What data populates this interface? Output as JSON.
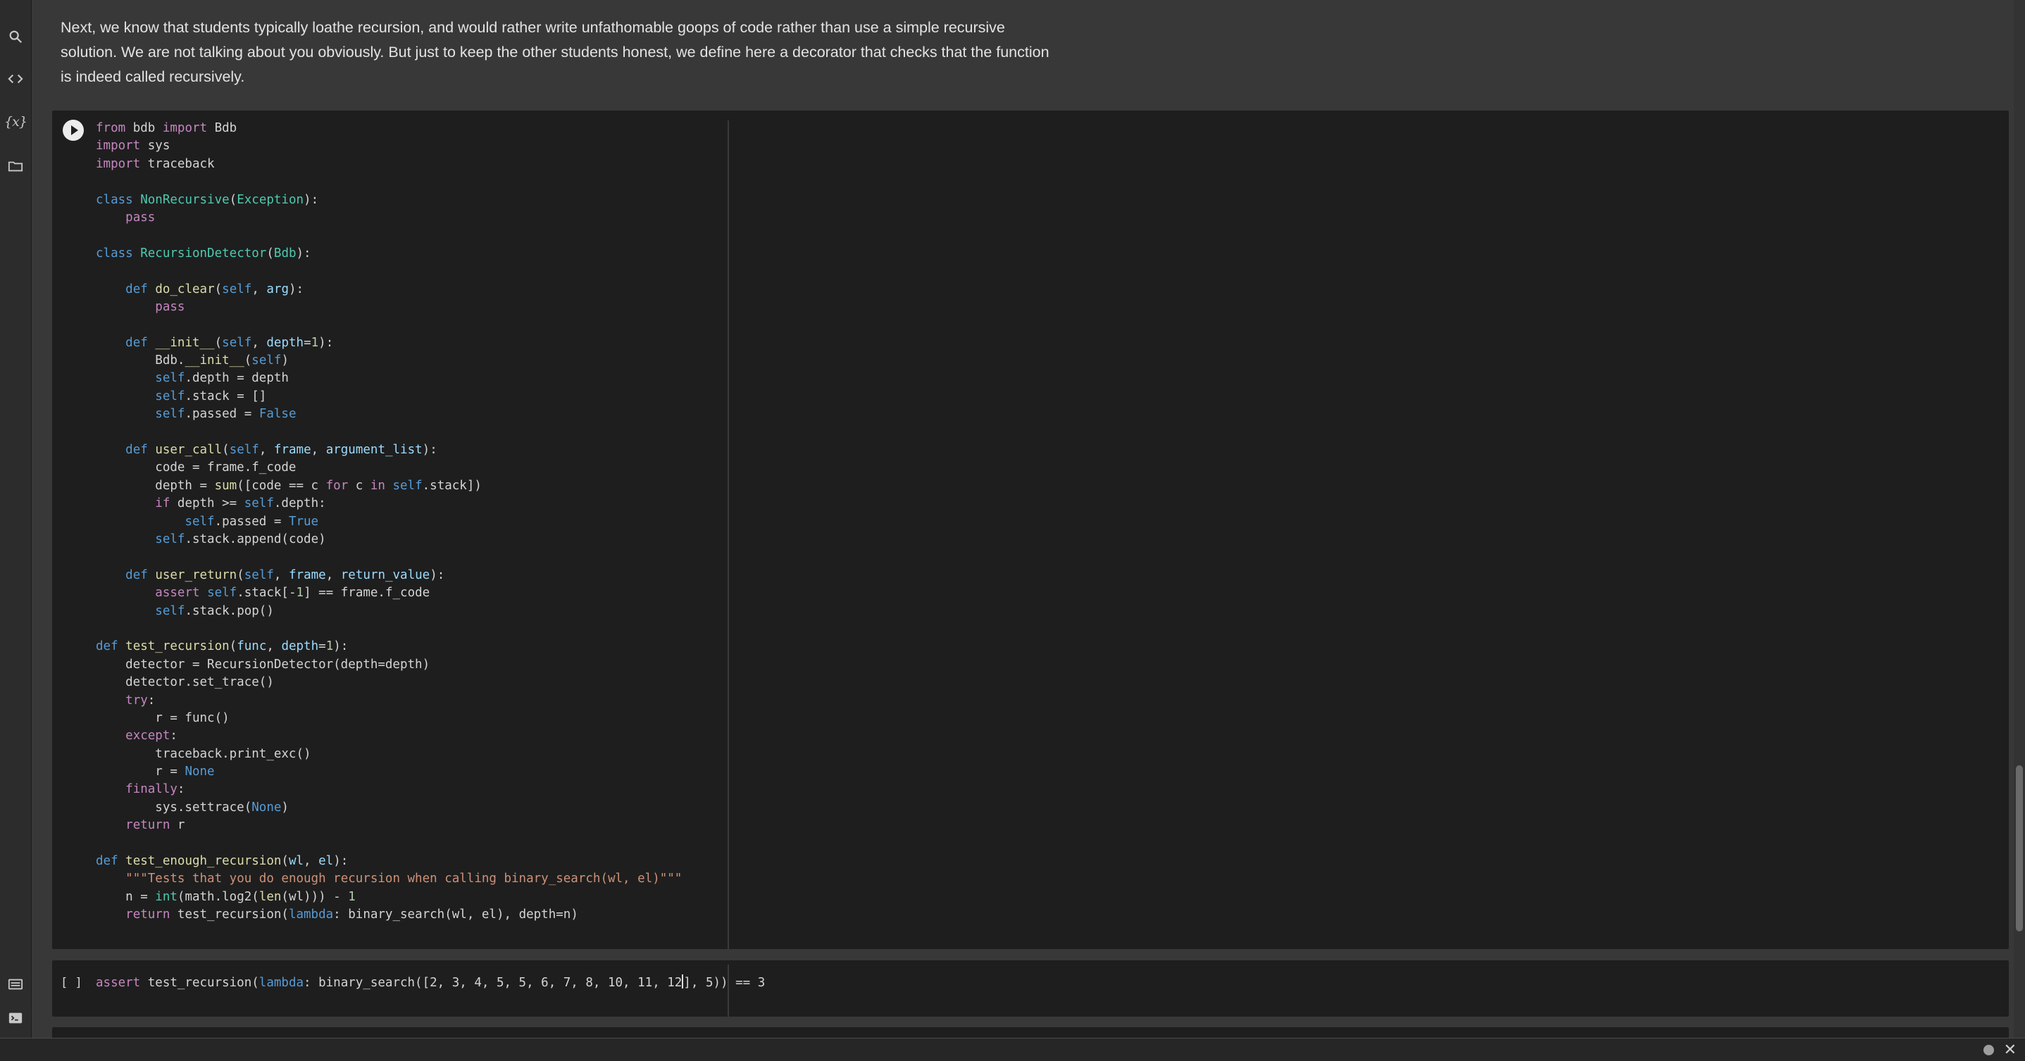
{
  "sidebar": {
    "icons": [
      "search-icon",
      "code-icon",
      "variables-icon",
      "folder-icon",
      "table-of-contents-icon",
      "terminal-icon"
    ],
    "variables_glyph": "{x}"
  },
  "text_cell": {
    "paragraph": "Next, we know that students typically loathe recursion, and would rather write unfathomable goops of code rather than use a simple recursive solution. We are not talking about you obviously. But just to keep the other students honest, we define here a decorator that checks that the function is indeed called recursively."
  },
  "code_cell_1": {
    "code": [
      [
        [
          "kw",
          "from"
        ],
        [
          "txt",
          " bdb "
        ],
        [
          "kw",
          "import"
        ],
        [
          "txt",
          " Bdb"
        ]
      ],
      [
        [
          "kw",
          "import"
        ],
        [
          "txt",
          " sys"
        ]
      ],
      [
        [
          "kw",
          "import"
        ],
        [
          "txt",
          " traceback"
        ]
      ],
      [],
      [
        [
          "kd",
          "class"
        ],
        [
          "txt",
          " "
        ],
        [
          "cls",
          "NonRecursive"
        ],
        [
          "txt",
          "("
        ],
        [
          "cls",
          "Exception"
        ],
        [
          "txt",
          "):"
        ]
      ],
      [
        [
          "txt",
          "    "
        ],
        [
          "kw",
          "pass"
        ]
      ],
      [],
      [
        [
          "kd",
          "class"
        ],
        [
          "txt",
          " "
        ],
        [
          "cls",
          "RecursionDetector"
        ],
        [
          "txt",
          "("
        ],
        [
          "cls",
          "Bdb"
        ],
        [
          "txt",
          "):"
        ]
      ],
      [],
      [
        [
          "txt",
          "    "
        ],
        [
          "kd",
          "def"
        ],
        [
          "txt",
          " "
        ],
        [
          "fn",
          "do_clear"
        ],
        [
          "txt",
          "("
        ],
        [
          "kd",
          "self"
        ],
        [
          "txt",
          ", "
        ],
        [
          "par",
          "arg"
        ],
        [
          "txt",
          "):"
        ]
      ],
      [
        [
          "txt",
          "        "
        ],
        [
          "kw",
          "pass"
        ]
      ],
      [],
      [
        [
          "txt",
          "    "
        ],
        [
          "kd",
          "def"
        ],
        [
          "txt",
          " "
        ],
        [
          "fn",
          "__init__"
        ],
        [
          "txt",
          "("
        ],
        [
          "kd",
          "self"
        ],
        [
          "txt",
          ", "
        ],
        [
          "par",
          "depth"
        ],
        [
          "txt",
          "="
        ],
        [
          "num",
          "1"
        ],
        [
          "txt",
          "):"
        ]
      ],
      [
        [
          "txt",
          "        Bdb."
        ],
        [
          "fn",
          "__init__"
        ],
        [
          "txt",
          "("
        ],
        [
          "kd",
          "self"
        ],
        [
          "txt",
          ")"
        ]
      ],
      [
        [
          "txt",
          "        "
        ],
        [
          "kd",
          "self"
        ],
        [
          "txt",
          ".depth = depth"
        ]
      ],
      [
        [
          "txt",
          "        "
        ],
        [
          "kd",
          "self"
        ],
        [
          "txt",
          ".stack = []"
        ]
      ],
      [
        [
          "txt",
          "        "
        ],
        [
          "kd",
          "self"
        ],
        [
          "txt",
          ".passed = "
        ],
        [
          "kd",
          "False"
        ]
      ],
      [],
      [
        [
          "txt",
          "    "
        ],
        [
          "kd",
          "def"
        ],
        [
          "txt",
          " "
        ],
        [
          "fn",
          "user_call"
        ],
        [
          "txt",
          "("
        ],
        [
          "kd",
          "self"
        ],
        [
          "txt",
          ", "
        ],
        [
          "par",
          "frame"
        ],
        [
          "txt",
          ", "
        ],
        [
          "par",
          "argument_list"
        ],
        [
          "txt",
          "):"
        ]
      ],
      [
        [
          "txt",
          "        code = frame.f_code"
        ]
      ],
      [
        [
          "txt",
          "        depth = "
        ],
        [
          "fn",
          "sum"
        ],
        [
          "txt",
          "([code == c "
        ],
        [
          "kw",
          "for"
        ],
        [
          "txt",
          " c "
        ],
        [
          "kw",
          "in"
        ],
        [
          "txt",
          " "
        ],
        [
          "kd",
          "self"
        ],
        [
          "txt",
          ".stack])"
        ]
      ],
      [
        [
          "txt",
          "        "
        ],
        [
          "kw",
          "if"
        ],
        [
          "txt",
          " depth >= "
        ],
        [
          "kd",
          "self"
        ],
        [
          "txt",
          ".depth:"
        ]
      ],
      [
        [
          "txt",
          "            "
        ],
        [
          "kd",
          "self"
        ],
        [
          "txt",
          ".passed = "
        ],
        [
          "kd",
          "True"
        ]
      ],
      [
        [
          "txt",
          "        "
        ],
        [
          "kd",
          "self"
        ],
        [
          "txt",
          ".stack.append(code)"
        ]
      ],
      [],
      [
        [
          "txt",
          "    "
        ],
        [
          "kd",
          "def"
        ],
        [
          "txt",
          " "
        ],
        [
          "fn",
          "user_return"
        ],
        [
          "txt",
          "("
        ],
        [
          "kd",
          "self"
        ],
        [
          "txt",
          ", "
        ],
        [
          "par",
          "frame"
        ],
        [
          "txt",
          ", "
        ],
        [
          "par",
          "return_value"
        ],
        [
          "txt",
          "):"
        ]
      ],
      [
        [
          "txt",
          "        "
        ],
        [
          "kw",
          "assert"
        ],
        [
          "txt",
          " "
        ],
        [
          "kd",
          "self"
        ],
        [
          "txt",
          ".stack[-"
        ],
        [
          "num",
          "1"
        ],
        [
          "txt",
          "] == frame.f_code"
        ]
      ],
      [
        [
          "txt",
          "        "
        ],
        [
          "kd",
          "self"
        ],
        [
          "txt",
          ".stack.pop()"
        ]
      ],
      [],
      [
        [
          "kd",
          "def"
        ],
        [
          "txt",
          " "
        ],
        [
          "fn",
          "test_recursion"
        ],
        [
          "txt",
          "("
        ],
        [
          "par",
          "func"
        ],
        [
          "txt",
          ", "
        ],
        [
          "par",
          "depth"
        ],
        [
          "txt",
          "="
        ],
        [
          "num",
          "1"
        ],
        [
          "txt",
          "):"
        ]
      ],
      [
        [
          "txt",
          "    detector = RecursionDetector(depth=depth)"
        ]
      ],
      [
        [
          "txt",
          "    detector.set_trace()"
        ]
      ],
      [
        [
          "txt",
          "    "
        ],
        [
          "kw",
          "try"
        ],
        [
          "txt",
          ":"
        ]
      ],
      [
        [
          "txt",
          "        r = func()"
        ]
      ],
      [
        [
          "txt",
          "    "
        ],
        [
          "kw",
          "except"
        ],
        [
          "txt",
          ":"
        ]
      ],
      [
        [
          "txt",
          "        traceback.print_exc()"
        ]
      ],
      [
        [
          "txt",
          "        r = "
        ],
        [
          "kd",
          "None"
        ]
      ],
      [
        [
          "txt",
          "    "
        ],
        [
          "kw",
          "finally"
        ],
        [
          "txt",
          ":"
        ]
      ],
      [
        [
          "txt",
          "        sys.settrace("
        ],
        [
          "kd",
          "None"
        ],
        [
          "txt",
          ")"
        ]
      ],
      [
        [
          "txt",
          "    "
        ],
        [
          "kw",
          "return"
        ],
        [
          "txt",
          " r"
        ]
      ],
      [],
      [
        [
          "kd",
          "def"
        ],
        [
          "txt",
          " "
        ],
        [
          "fn",
          "test_enough_recursion"
        ],
        [
          "txt",
          "("
        ],
        [
          "par",
          "wl"
        ],
        [
          "txt",
          ", "
        ],
        [
          "par",
          "el"
        ],
        [
          "txt",
          "):"
        ]
      ],
      [
        [
          "txt",
          "    "
        ],
        [
          "str",
          "\"\"\"Tests that you do enough recursion when calling binary_search(wl, el)\"\"\""
        ]
      ],
      [
        [
          "txt",
          "    n = "
        ],
        [
          "cls",
          "int"
        ],
        [
          "txt",
          "(math.log2("
        ],
        [
          "fn",
          "len"
        ],
        [
          "txt",
          "(wl))) - "
        ],
        [
          "num",
          "1"
        ]
      ],
      [
        [
          "txt",
          "    "
        ],
        [
          "kw",
          "return"
        ],
        [
          "txt",
          " test_recursion("
        ],
        [
          "kd",
          "lambda"
        ],
        [
          "txt",
          ": binary_search(wl, el), depth=n)"
        ]
      ]
    ]
  },
  "code_cell_2": {
    "exec_count": "[ ]",
    "code": [
      [
        [
          "kw",
          "assert"
        ],
        [
          "txt",
          " test_recursion("
        ],
        [
          "kd",
          "lambda"
        ],
        [
          "txt",
          ": binary_search([2, 3, 4, 5, 5, 6, 7, 8, 10, 11, 12"
        ],
        [
          "txt",
          "]"
        ],
        [
          "txt",
          ", 5)) == 3"
        ]
      ]
    ]
  },
  "colors": {
    "background": "#383838",
    "cell_background": "#1e1e1e",
    "keyword": "#c586c0",
    "declaration": "#569cd6",
    "class_name": "#4ec9b0",
    "function": "#dcdcaa",
    "number": "#b5cea8",
    "string": "#ce9178"
  }
}
